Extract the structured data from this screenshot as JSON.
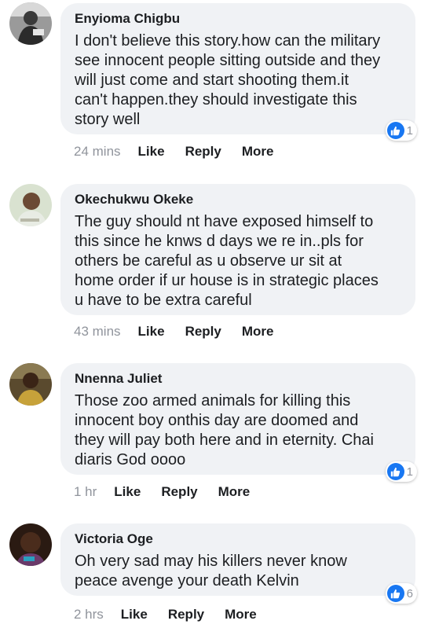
{
  "accent_color": "#1877f2",
  "comments": [
    {
      "author": "Enyioma Chigbu",
      "text": "I don't believe this story.how can the military\nsee innocent people sitting outside and they\nwill just come and start shooting them.it\ncan't happen.they should investigate this\nstory well",
      "time": "24 mins",
      "reaction_icon": "like-thumb-icon",
      "reactions": "1"
    },
    {
      "author": "Okechukwu Okeke",
      "text": "The guy should nt have exposed himself to\nthis since he knws d days we re in..pls for\nothers be careful as u observe ur sit at\nhome order if ur house is in strategic places\nu have to be extra careful",
      "time": "43 mins"
    },
    {
      "author": "Nnenna Juliet",
      "text": "Those zoo armed animals for killing this\ninnocent boy onthis day are doomed and\nthey will pay both here and in eternity. Chai\ndiaris God oooo",
      "time": "1 hr",
      "reaction_icon": "like-thumb-icon",
      "reactions": "1"
    },
    {
      "author": "Victoria Oge",
      "text": "Oh very sad may his killers never know\npeace avenge your death Kelvin",
      "time": "2 hrs",
      "reaction_icon": "like-thumb-icon",
      "reactions": "6"
    }
  ],
  "actions": {
    "like": "Like",
    "reply": "Reply",
    "more": "More"
  }
}
